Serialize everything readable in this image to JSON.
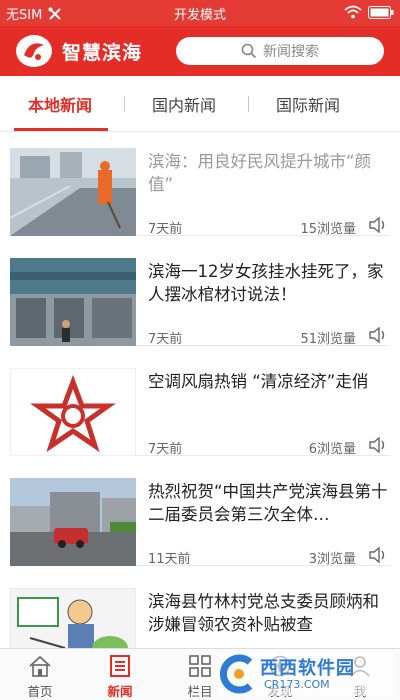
{
  "status_bar": {
    "carrier": "无SIM",
    "center_text": "开发模式"
  },
  "header": {
    "app_title": "智慧滨海",
    "search_placeholder": "新闻搜索",
    "brand_color": "#e52d27"
  },
  "tabs": [
    {
      "label": "本地新闻",
      "active": true
    },
    {
      "label": "国内新闻",
      "active": false
    },
    {
      "label": "国际新闻",
      "active": false
    }
  ],
  "news": [
    {
      "title": "滨海：用良好民风提升城市“颜值”",
      "time": "7天前",
      "views": "15浏览量",
      "read": true,
      "thumb": "street-sweeper-photo"
    },
    {
      "title": "滨海一12岁女孩挂水挂死了，家人摆冰棺材讨说法！",
      "time": "7天前",
      "views": "51浏览量",
      "read": false,
      "thumb": "clinic-building-photo"
    },
    {
      "title": "空调风扇热销 “清凉经济”走俏",
      "time": "7天前",
      "views": "6浏览量",
      "read": false,
      "thumb": "star-logo"
    },
    {
      "title": "热烈祝贺“中国共产党滨海县第十二届委员会第三次全体…",
      "time": "11天前",
      "views": "3浏览量",
      "read": false,
      "thumb": "road-building-photo"
    },
    {
      "title": "滨海县竹林村党总支委员顾炳和涉嫌冒领农资补贴被查",
      "time": "",
      "views": "",
      "read": false,
      "thumb": "cartoon-illustration"
    }
  ],
  "bottom_nav": [
    {
      "label": "首页",
      "icon": "home-icon",
      "active": false
    },
    {
      "label": "新闻",
      "icon": "news-icon",
      "active": true
    },
    {
      "label": "栏目",
      "icon": "grid-icon",
      "active": false
    },
    {
      "label": "发现",
      "icon": "compass-icon",
      "active": false
    },
    {
      "label": "我",
      "icon": "person-icon",
      "active": false
    }
  ],
  "watermark": {
    "text": "西西软件园",
    "sub": "CR173.COM"
  }
}
